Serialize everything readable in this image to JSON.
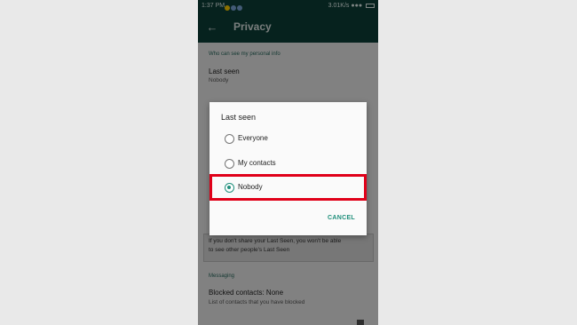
{
  "status_bar": {
    "time": "1:37 PM",
    "network_speed": "3.01K/s"
  },
  "app_bar": {
    "back_icon": "arrow-left-icon",
    "title": "Privacy"
  },
  "page": {
    "section_personal": "Who can see my personal info",
    "last_seen_title": "Last seen",
    "last_seen_value": "Nobody",
    "info_text_line1": "If you don't share your Last Seen, you won't be able",
    "info_text_line2": "to see other people's Last Seen",
    "section_messaging": "Messaging",
    "blocked_title": "Blocked contacts: None",
    "blocked_sub": "List of contacts that you have blocked"
  },
  "dialog": {
    "title": "Last seen",
    "options": [
      {
        "label": "Everyone",
        "selected": false
      },
      {
        "label": "My contacts",
        "selected": false
      },
      {
        "label": "Nobody",
        "selected": true
      }
    ],
    "cancel_label": "CANCEL",
    "highlight_color": "#e00019",
    "accent_color": "#1f8f7b"
  }
}
